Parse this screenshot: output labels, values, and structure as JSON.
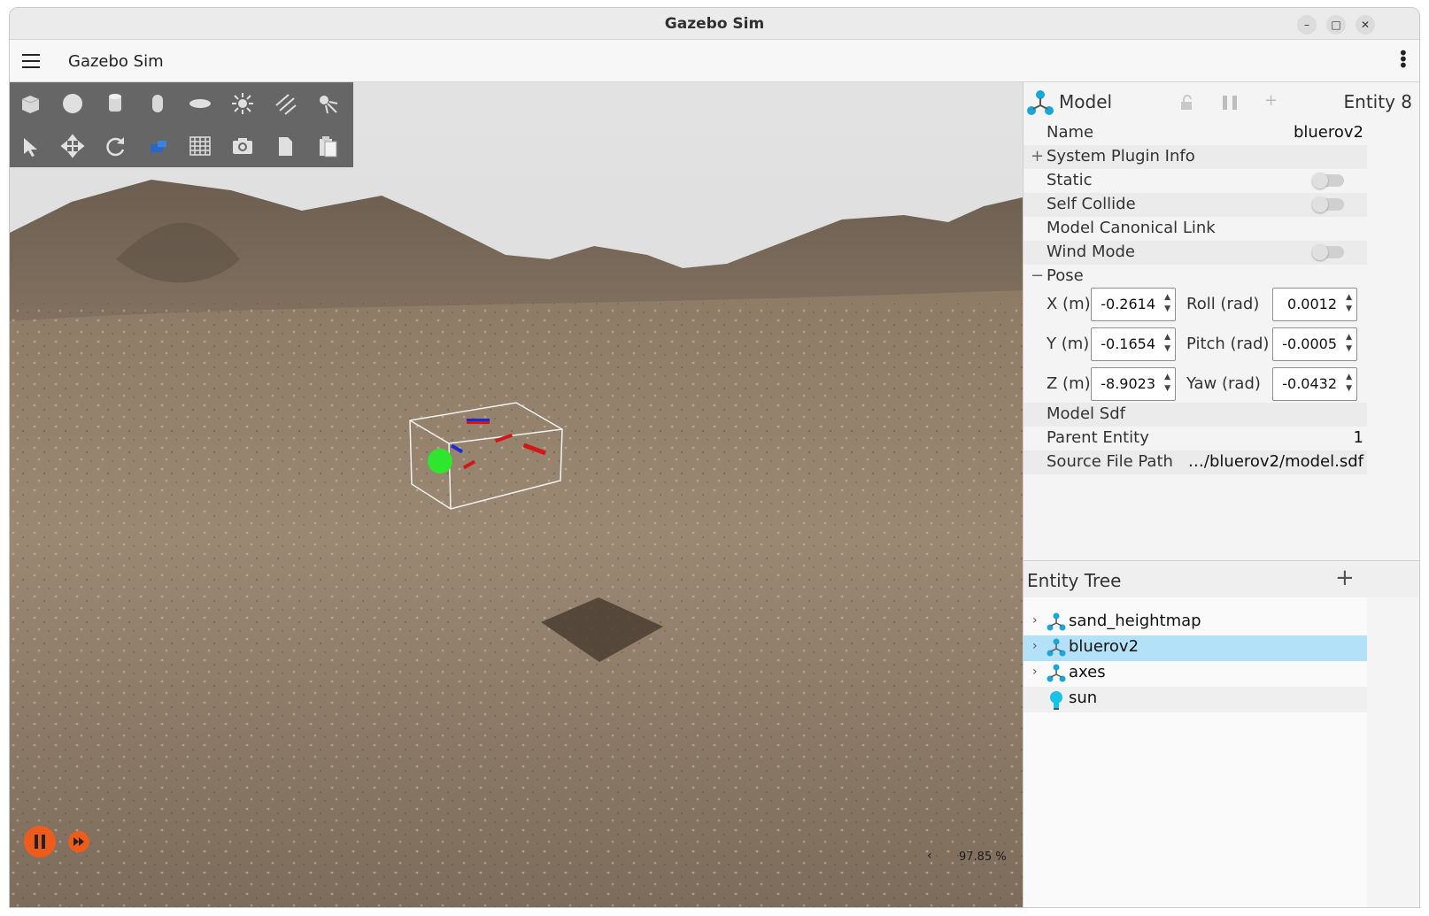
{
  "window": {
    "title": "Gazebo Sim",
    "controls": [
      "–",
      "□",
      "✕"
    ]
  },
  "appbar": {
    "title": "Gazebo Sim"
  },
  "toolbar": {
    "row1": [
      "box-icon",
      "sphere-icon",
      "cylinder-icon",
      "capsule-icon",
      "ellipsoid-icon",
      "sun-icon",
      "directional-light-icon",
      "spot-light-icon"
    ],
    "row2": [
      "select-icon",
      "translate-icon",
      "rotate-icon",
      "insert-mesh-icon",
      "grid-icon",
      "camera-icon",
      "copy-icon",
      "paste-icon"
    ]
  },
  "viewport": {
    "rtf": "97.85 %",
    "rtf_arrow": "‹"
  },
  "component_inspector": {
    "type": "Model",
    "entity": "Entity 8",
    "rows": {
      "name_label": "Name",
      "name_value": "bluerov2",
      "system_plugin_info": "System Plugin Info",
      "expand_symbol": "+",
      "static": "Static",
      "self_collide": "Self Collide",
      "canonical_link": "Model Canonical Link",
      "wind_mode": "Wind Mode",
      "pose": "Pose",
      "collapse_symbol": "−",
      "model_sdf": "Model Sdf",
      "parent_entity_label": "Parent Entity",
      "parent_entity_value": "1",
      "source_file_label": "Source File Path",
      "source_file_value": "…/bluerov2/model.sdf"
    },
    "pose": {
      "x_label": "X (m)",
      "x": "-0.2614",
      "y_label": "Y (m)",
      "y": "-0.1654",
      "z_label": "Z (m)",
      "z": "-8.9023",
      "roll_label": "Roll (rad)",
      "roll": "0.0012",
      "pitch_label": "Pitch (rad)",
      "pitch": "-0.0005",
      "yaw_label": "Yaw (rad)",
      "yaw": "-0.0432"
    }
  },
  "entity_tree": {
    "title": "Entity Tree",
    "add_symbol": "+",
    "items": [
      {
        "name": "sand_heightmap",
        "icon": "model-icon"
      },
      {
        "name": "bluerov2",
        "icon": "model-icon"
      },
      {
        "name": "axes",
        "icon": "model-icon"
      },
      {
        "name": "sun",
        "icon": "light-bulb-icon"
      }
    ]
  },
  "colors": {
    "play_button": "#ef5b1b",
    "selection": "#b3e2f8",
    "model_icon": "#1aa7d8"
  }
}
